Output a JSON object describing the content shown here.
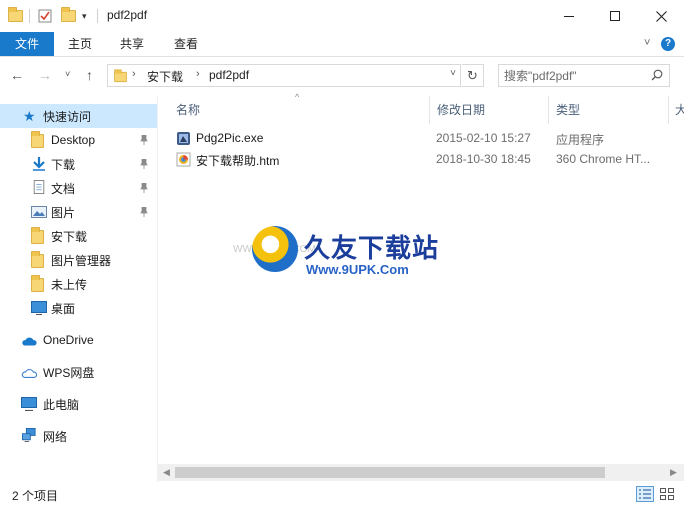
{
  "window": {
    "title": "pdf2pdf",
    "minimize_label": "minimize",
    "maximize_label": "maximize",
    "close_label": "close"
  },
  "ribbon": {
    "tabs": [
      {
        "label": "文件"
      },
      {
        "label": "主页"
      },
      {
        "label": "共享"
      },
      {
        "label": "查看"
      }
    ],
    "expand_icon": "chevron-down-icon",
    "help_label": "?"
  },
  "navigation": {
    "breadcrumb": [
      "安下载",
      "pdf2pdf"
    ],
    "search_placeholder": "搜索\"pdf2pdf\""
  },
  "sidebar": {
    "quick_access": {
      "label": "快速访问"
    },
    "items": [
      {
        "label": "Desktop",
        "pinned": true,
        "icon": "folder-icon"
      },
      {
        "label": "下载",
        "pinned": true,
        "icon": "download-icon"
      },
      {
        "label": "文档",
        "pinned": true,
        "icon": "document-icon"
      },
      {
        "label": "图片",
        "pinned": true,
        "icon": "picture-icon"
      },
      {
        "label": "安下载",
        "pinned": false,
        "icon": "folder-icon"
      },
      {
        "label": "图片管理器",
        "pinned": false,
        "icon": "folder-icon"
      },
      {
        "label": "未上传",
        "pinned": false,
        "icon": "folder-icon"
      },
      {
        "label": "桌面",
        "pinned": false,
        "icon": "desktop-icon"
      }
    ],
    "onedrive": {
      "label": "OneDrive"
    },
    "wps": {
      "label": "WPS网盘"
    },
    "this_pc": {
      "label": "此电脑"
    },
    "network": {
      "label": "网络"
    }
  },
  "columns": {
    "name": "名称",
    "modified": "修改日期",
    "type": "类型",
    "size": "大"
  },
  "files": [
    {
      "name": "Pdg2Pic.exe",
      "modified": "2015-02-10 15:27",
      "type": "应用程序",
      "icon": "exe-icon"
    },
    {
      "name": "安下载帮助.htm",
      "modified": "2018-10-30 18:45",
      "type": "360 Chrome HT...",
      "icon": "html-file-icon"
    }
  ],
  "watermark": {
    "title": "久友下载站",
    "url": "Www.9UPK.Com",
    "ghost": "WWW.9UPK.COM"
  },
  "status": {
    "item_count": "2 个项目"
  },
  "colors": {
    "accent": "#1979ca",
    "selected": "#cce8ff",
    "header_text": "#4c607a"
  }
}
